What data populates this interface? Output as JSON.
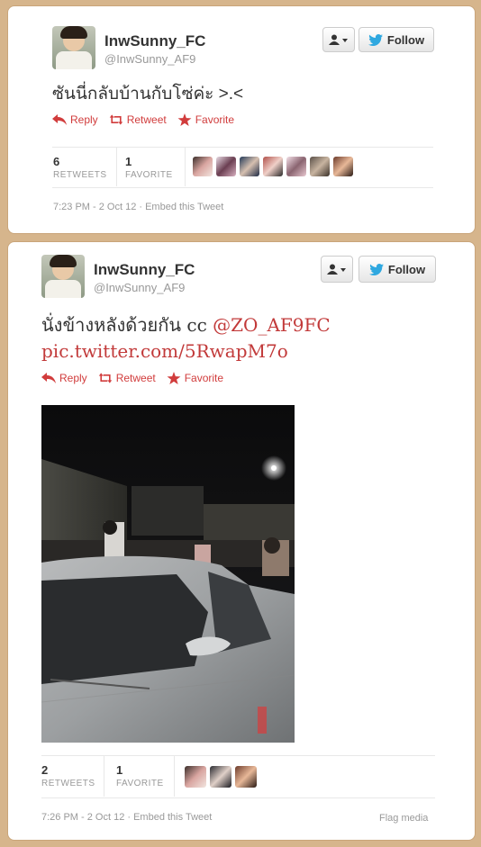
{
  "tweets": [
    {
      "name": "InwSunny_FC",
      "handle": "@InwSunny_AF9",
      "text": "ซันนี่กลับบ้านกับโซ่ค่ะ >.<",
      "actions": {
        "reply": "Reply",
        "retweet": "Retweet",
        "favorite": "Favorite"
      },
      "retweets": {
        "count": "6",
        "label": "RETWEETS"
      },
      "favorites": {
        "count": "1",
        "label": "FAVORITE"
      },
      "avatar_count": 7,
      "timestamp": "7:23 PM - 2 Oct 12 · Embed this Tweet",
      "follow_label": "Follow"
    },
    {
      "name": "InwSunny_FC",
      "handle": "@InwSunny_AF9",
      "text_plain": "นั่งข้างหลังด้วยกัน cc ",
      "mention": "@ZO_AF9FC",
      "pic_link": "pic.twitter.com/5RwapM7o",
      "actions": {
        "reply": "Reply",
        "retweet": "Retweet",
        "favorite": "Favorite"
      },
      "retweets": {
        "count": "2",
        "label": "RETWEETS"
      },
      "favorites": {
        "count": "1",
        "label": "FAVORITE"
      },
      "avatar_count": 3,
      "timestamp": "7:26 PM - 2 Oct 12 · Embed this Tweet",
      "flag_media": "Flag media",
      "follow_label": "Follow"
    }
  ],
  "colors": {
    "background": "#d6b58c",
    "action_red": "#d13c3c",
    "link_red": "#c23a3a",
    "twitter_blue": "#2fa8e0"
  },
  "icons": [
    "reply-icon",
    "retweet-icon",
    "favorite-star-icon",
    "user-dropdown-icon",
    "twitter-bird-icon"
  ]
}
